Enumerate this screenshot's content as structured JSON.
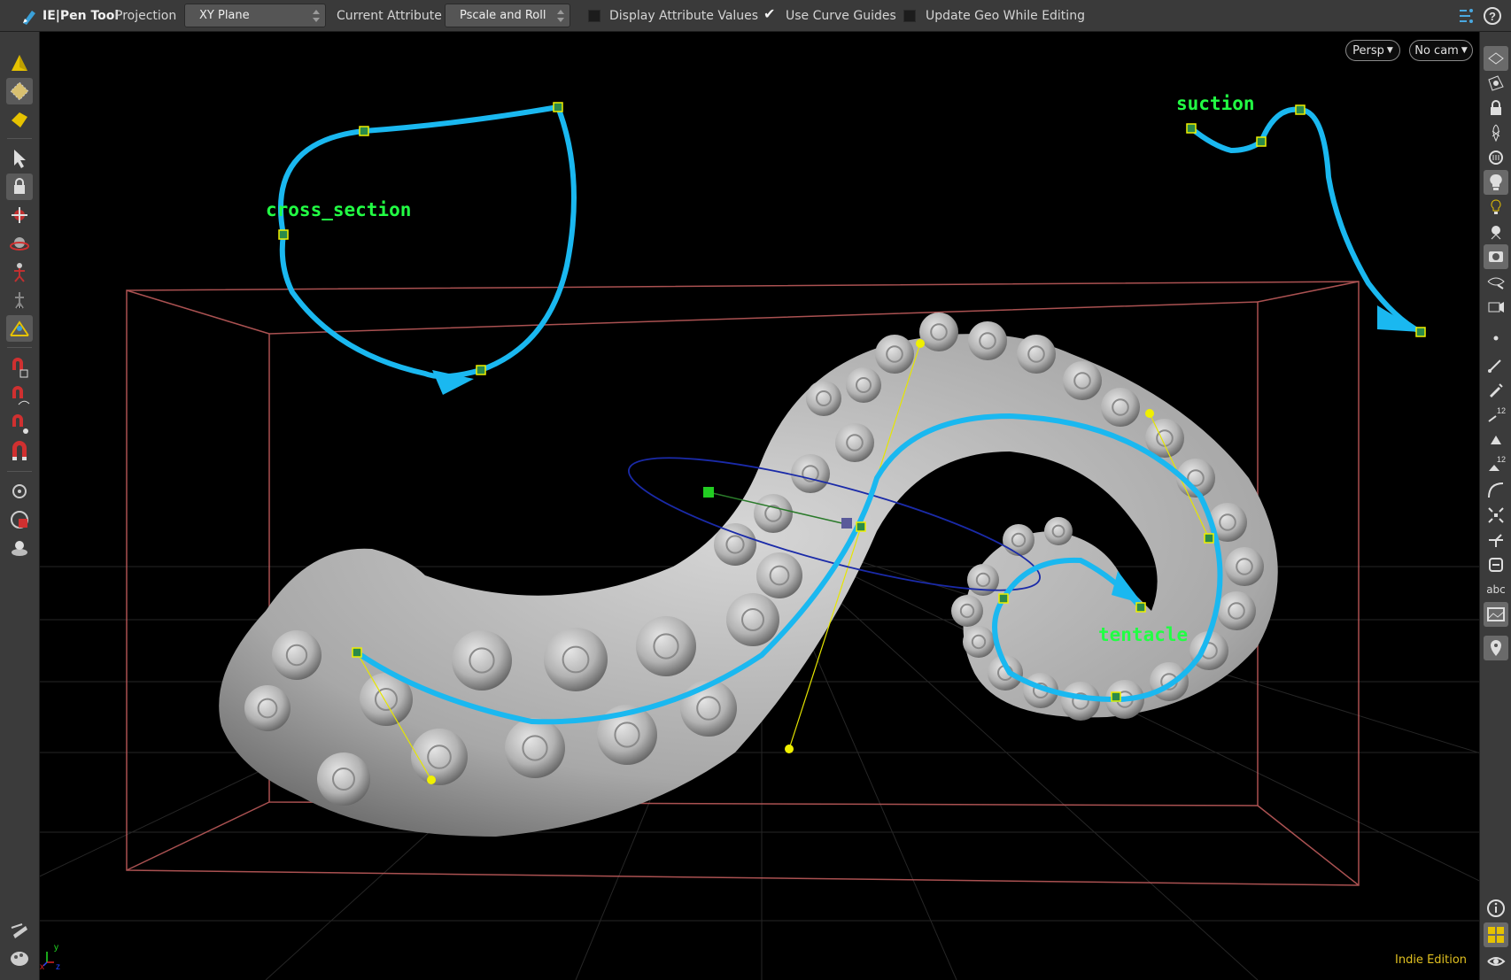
{
  "topbar": {
    "tool_name": "IE|Pen Tool",
    "projection_label": "Projection",
    "projection_value": "XY Plane",
    "current_attribute_label": "Current Attribute",
    "current_attribute_value": "Pscale and Roll",
    "display_attr_values_label": "Display Attribute Values",
    "display_attr_values_checked": false,
    "use_curve_guides_label": "Use Curve Guides",
    "use_curve_guides_checked": true,
    "update_geo_label": "Update Geo While Editing",
    "update_geo_checked": false,
    "help_icon": "help-icon",
    "tool_icon": "pen-tool-icon"
  },
  "viewport": {
    "camera_mode": "Persp",
    "camera_select": "No cam",
    "edition": "Indie Edition",
    "curve_labels": [
      "cross_section",
      "suction",
      "tentacle"
    ],
    "axis_labels": {
      "x": "x",
      "y": "y",
      "z": "z"
    }
  },
  "leftbar": {
    "tools": [
      "view-tool-icon",
      "select-mode-icon",
      "object-mode-icon",
      "select-arrow-icon",
      "lock-icon",
      "handle-icon",
      "rotate-icon",
      "pose-icon",
      "bone-icon",
      "pen-tool-icon",
      "magnet-grid-icon",
      "magnet-curve-icon",
      "magnet-point-icon",
      "magnet-icon",
      "snap-icon",
      "camera-icon",
      "display-icon",
      "pin-icon",
      "palette-icon"
    ]
  },
  "rightbar": {
    "tools": [
      "wireframe-icon",
      "shading-icon",
      "lock-icon",
      "xray-icon",
      "ghost-icon",
      "light-icon",
      "light-icon",
      "lightbulb-icon",
      "camera-view-icon",
      "visibility-icon",
      "visibility-icon",
      "point-icon",
      "brush-icon",
      "pencil-icon",
      "number-icon",
      "fill-icon",
      "number-icon",
      "curve-icon",
      "grid-snap-icon",
      "joint-icon",
      "list-icon",
      "abc-icon",
      "background-icon",
      "pin-icon",
      "info-icon",
      "layout-icon",
      "eye-icon"
    ],
    "abc_label": "abc",
    "num_12_a": "12",
    "num_12_b": "12"
  }
}
